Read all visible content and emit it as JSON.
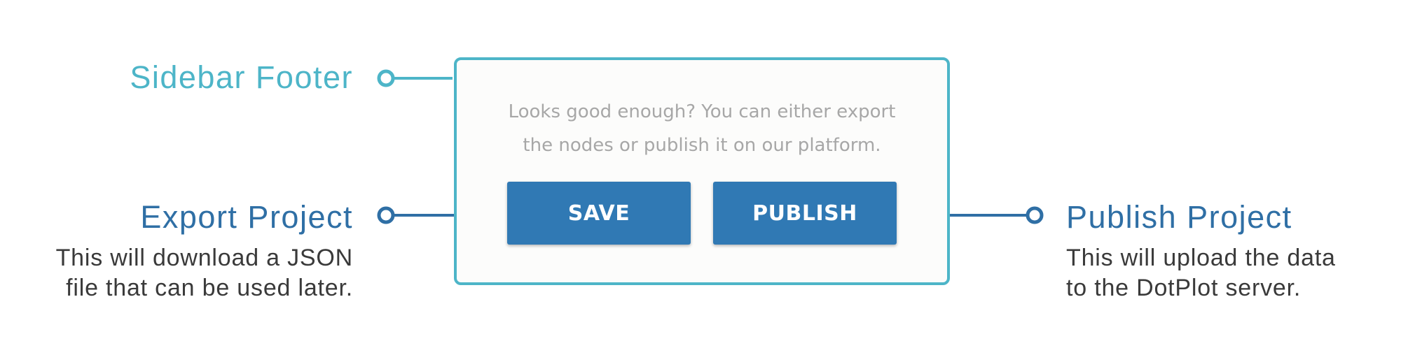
{
  "callouts": {
    "sidebar_footer": {
      "title": "Sidebar Footer"
    },
    "export_project": {
      "title": "Export Project",
      "description": "This will download a JSON\nfile that can be used later."
    },
    "publish_project": {
      "title": "Publish Project",
      "description": "This will upload the data\nto the DotPlot server."
    }
  },
  "footer": {
    "message": "Looks good enough? You can either export\nthe nodes or publish it on our platform.",
    "save_label": "SAVE",
    "publish_label": "PUBLISH"
  },
  "colors": {
    "footer_accent": "#4db5c8",
    "action_accent": "#2f6fa5",
    "button_fill": "#3079b4",
    "message_text": "#a7a7a7",
    "description_text": "#3a3a3a"
  }
}
